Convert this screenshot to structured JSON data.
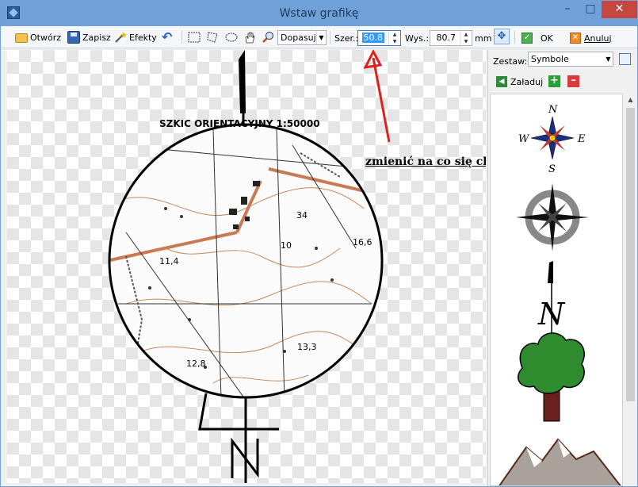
{
  "window": {
    "title": "Wstaw grafikę"
  },
  "toolbar": {
    "open_label": "Otwórz",
    "save_label": "Zapisz",
    "effects_label": "Efekty",
    "fit_select": "Dopasuj",
    "width_label": "Szer.:",
    "width_value": "50.8",
    "height_label": "Wys.:",
    "height_value": "80.7",
    "unit_label": "mm",
    "ok_label": "OK",
    "cancel_label": "Anuluj"
  },
  "canvas": {
    "map_title": "SZKIC ORIENTACYJNY 1:50000",
    "annotation": "zmienić na co się chce",
    "map_labels": [
      "34",
      "10",
      "16,6",
      "11,4",
      "13,3",
      "12,8"
    ]
  },
  "panel": {
    "set_label": "Zestaw:",
    "set_value": "Symbole",
    "load_label": "Załaduj",
    "compass_letters": [
      "N",
      "W",
      "E",
      "S"
    ],
    "arrow_letter": "N"
  },
  "colors": {
    "accent": "#3399ff",
    "annotation_arrow": "#e02020",
    "titlebar": "#6fa0d8"
  }
}
